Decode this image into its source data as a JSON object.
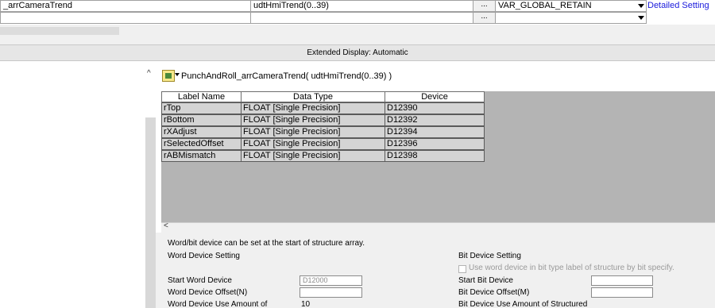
{
  "variable_row": {
    "label_name": "_arrCameraTrend",
    "data_type": "udtHmiTrend(0..39)",
    "browse_label": "...",
    "class": "VAR_GLOBAL_RETAIN",
    "detail_link": "Detailed Setting"
  },
  "second_row": {
    "browse_label": "..."
  },
  "extended_display": "Extended Display: Automatic",
  "struct": {
    "title": "PunchAndRoll_arrCameraTrend( udtHmiTrend(0..39) )",
    "columns": [
      "Label Name",
      "Data Type",
      "Device"
    ],
    "rows": [
      {
        "label": "rTop",
        "type": "FLOAT [Single Precision]",
        "device": "D12390"
      },
      {
        "label": "rBottom",
        "type": "FLOAT [Single Precision]",
        "device": "D12392"
      },
      {
        "label": "rXAdjust",
        "type": "FLOAT [Single Precision]",
        "device": "D12394"
      },
      {
        "label": "rSelectedOffset",
        "type": "FLOAT [Single Precision]",
        "device": "D12396"
      },
      {
        "label": "rABMismatch",
        "type": "FLOAT [Single Precision]",
        "device": "D12398"
      }
    ]
  },
  "settings": {
    "note": "Word/bit device can be set at the start of structure array.",
    "word_heading": "Word Device Setting",
    "start_word_label": "Start Word Device",
    "start_word_value": "D12000",
    "word_offset_label": "Word Device Offset(N)",
    "word_offset_value": "",
    "word_use_label": "Word Device Use Amount of",
    "word_use_value": "10",
    "bit_heading": "Bit Device Setting",
    "bit_check_label": "Use word device in bit type label of structure by bit specify.",
    "start_bit_label": "Start Bit Device",
    "start_bit_value": "",
    "bit_offset_label": "Bit Device Offset(M)",
    "bit_offset_value": "",
    "bit_use_label": "Bit Device Use Amount of Structured"
  },
  "colors": {
    "table_bg": "#b4b4b4",
    "cell_bg": "#d4d4d4",
    "link": "#1a1adc"
  }
}
